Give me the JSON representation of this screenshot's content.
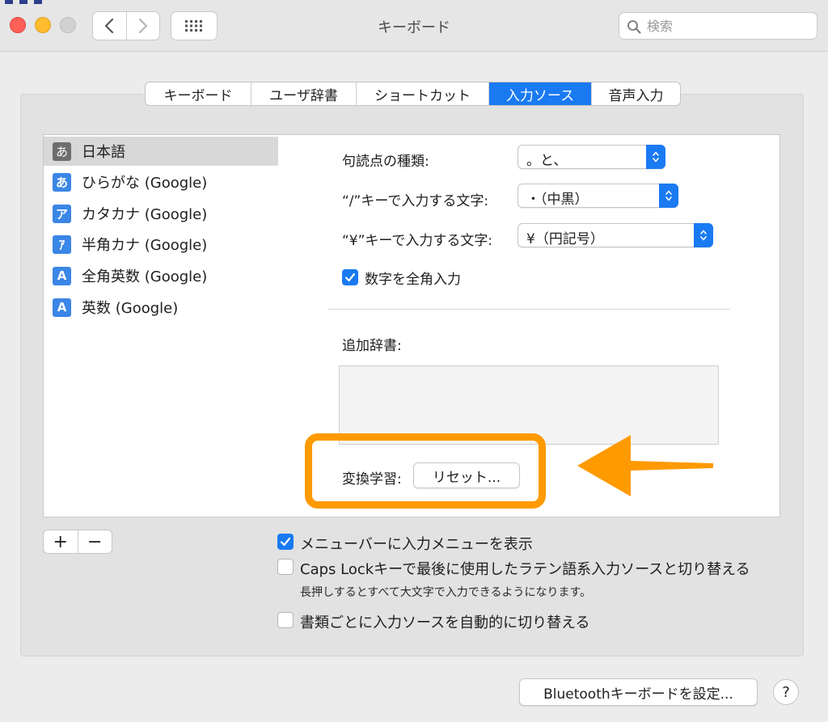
{
  "window": {
    "title": "キーボード"
  },
  "search": {
    "placeholder": "検索"
  },
  "tabs": [
    {
      "label": "キーボード",
      "active": false
    },
    {
      "label": "ユーザ辞書",
      "active": false
    },
    {
      "label": "ショートカット",
      "active": false
    },
    {
      "label": "入力ソース",
      "active": true
    },
    {
      "label": "音声入力",
      "active": false
    }
  ],
  "sources": [
    {
      "icon": "あ",
      "label": "日本語",
      "selected": true
    },
    {
      "icon": "あ",
      "label": "ひらがな (Google)"
    },
    {
      "icon": "ア",
      "label": "カタカナ (Google)"
    },
    {
      "icon": "ｱ",
      "label": "半角カナ (Google)"
    },
    {
      "icon": "A",
      "label": "全角英数 (Google)"
    },
    {
      "icon": "A",
      "label": "英数 (Google)"
    }
  ],
  "settings": {
    "punctuation": {
      "label": "句読点の種類:",
      "value": "。と、"
    },
    "slash": {
      "label": "“/”キーで入力する文字:",
      "value": "・（中黒）"
    },
    "yen": {
      "label": "“¥”キーで入力する文字:",
      "value": "¥（円記号）"
    },
    "fullwidth_numbers": {
      "label": "数字を全角入力",
      "checked": true
    },
    "extra_dict_label": "追加辞書:",
    "learning_label": "変換学習:",
    "reset_button": "リセット..."
  },
  "list_controls": {
    "add": "+",
    "remove": "−"
  },
  "options": {
    "show_menu": {
      "label": "メニューバーに入力メニューを表示",
      "checked": true
    },
    "caps_lock": {
      "label": "Caps Lockキーで最後に使用したラテン語系入力ソースと切り替える",
      "checked": false
    },
    "caps_note": "長押しするとすべて大文字で入力できるようになります。",
    "auto_switch": {
      "label": "書類ごとに入力ソースを自動的に切り替える",
      "checked": false
    }
  },
  "footer": {
    "bluetooth_button": "Bluetoothキーボードを設定...",
    "help": "?"
  },
  "colors": {
    "accent": "#1a7af2",
    "annotation": "#ff9a00"
  }
}
